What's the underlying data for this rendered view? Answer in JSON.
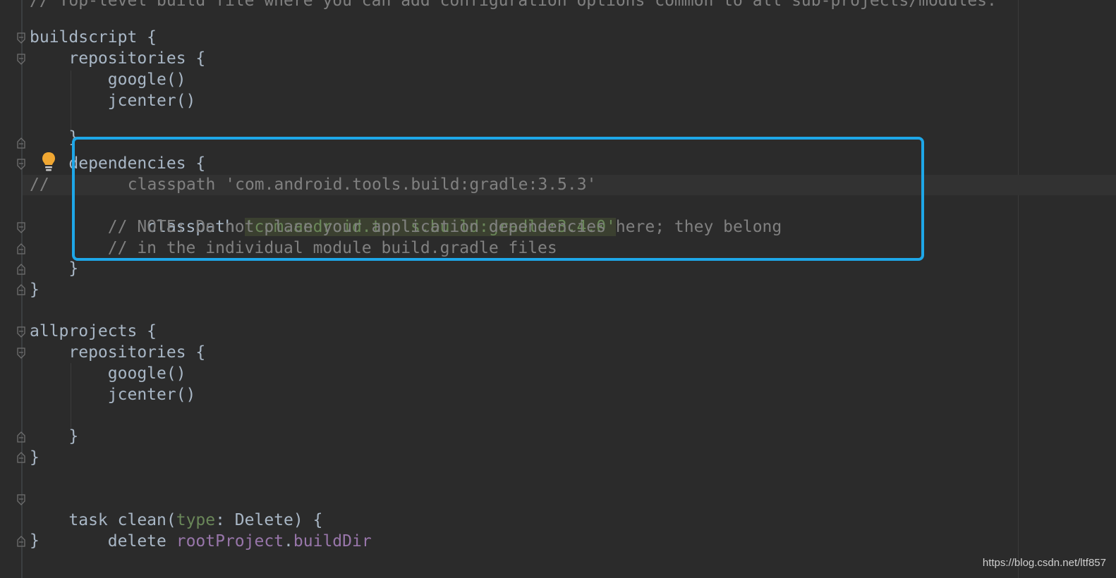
{
  "editor": {
    "lines": {
      "header_comment": "// Top-level build file where you can add configuration options common to all sub-projects/modules.",
      "l_buildscript": "buildscript {",
      "l_repositories_1": "    repositories {",
      "l_google_1": "        google()",
      "l_jcenter_1": "        jcenter()",
      "l_close_repos_1": "    }",
      "l_dependencies": "    dependencies {",
      "l_commented_prefix": "//",
      "l_commented_classpath": "        classpath 'com.android.tools.build:gradle:3.5.3'",
      "l_classpath_keyword": "        classpath ",
      "l_classpath_value": "'com.android.tools.build:gradle:3.4.0'",
      "l_note_1": "        // NOTE: Do not place your application dependencies here; they belong",
      "l_note_2": "        // in the individual module build.gradle files",
      "l_close_deps": "    }",
      "l_close_buildscript": "}",
      "l_allprojects": "allprojects {",
      "l_repositories_2": "    repositories {",
      "l_google_2": "        google()",
      "l_jcenter_2": "        jcenter()",
      "l_close_repos_2": "    }",
      "l_close_allprojects": "}",
      "l_task_prefix": "task clean(",
      "l_task_param": "type",
      "l_task_suffix": ": Delete) {",
      "l_delete_prefix": "    delete ",
      "l_delete_obj": "rootProject",
      "l_delete_dot": ".",
      "l_delete_field": "buildDir",
      "l_close_task": "}"
    },
    "highlight_color": "#1ea7e8",
    "intention_icon": "lightbulb-icon"
  },
  "watermark": "https://blog.csdn.net/ltf857"
}
